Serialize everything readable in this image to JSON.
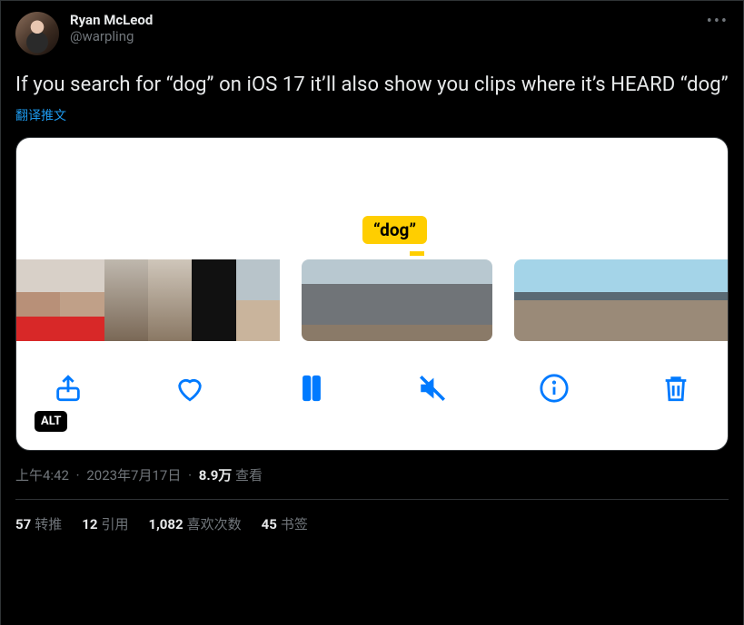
{
  "author": {
    "name": "Ryan McLeod",
    "handle": "@warpling"
  },
  "tweet_text": "If you search for “dog” on iOS 17 it’ll also show you clips where it’s HEARD “dog”",
  "translate_label": "翻译推文",
  "media": {
    "marker_label": "“dog”",
    "alt_badge": "ALT"
  },
  "meta": {
    "time": "上午4:42",
    "date": "2023年7月17日",
    "views_value": "8.9万",
    "views_label": "查看"
  },
  "stats": {
    "retweets": {
      "value": "57",
      "label": "转推"
    },
    "quotes": {
      "value": "12",
      "label": "引用"
    },
    "likes": {
      "value": "1,082",
      "label": "喜欢次数"
    },
    "bookmarks": {
      "value": "45",
      "label": "书签"
    }
  }
}
